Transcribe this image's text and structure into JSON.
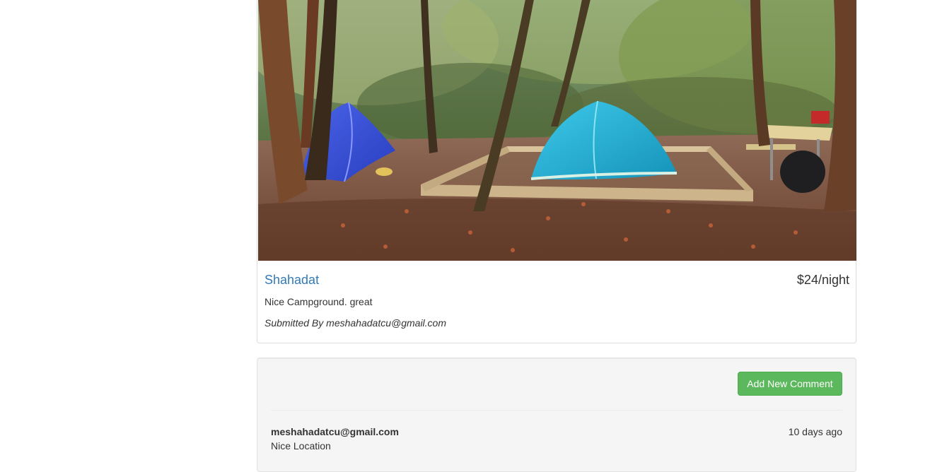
{
  "campground": {
    "name": "Shahadat",
    "price": "$24/night",
    "description": "Nice Campground. great",
    "submitted_by": "Submitted By meshahadatcu@gmail.com",
    "image_alt": "Campground photo with tents in the forest"
  },
  "comments_section": {
    "add_button_label": "Add New Comment",
    "comments": [
      {
        "author": "meshahadatcu@gmail.com",
        "time": "10 days ago",
        "text": "Nice Location"
      }
    ]
  },
  "colors": {
    "link": "#337ab7",
    "success": "#5cb85c",
    "well_bg": "#f5f5f5"
  }
}
